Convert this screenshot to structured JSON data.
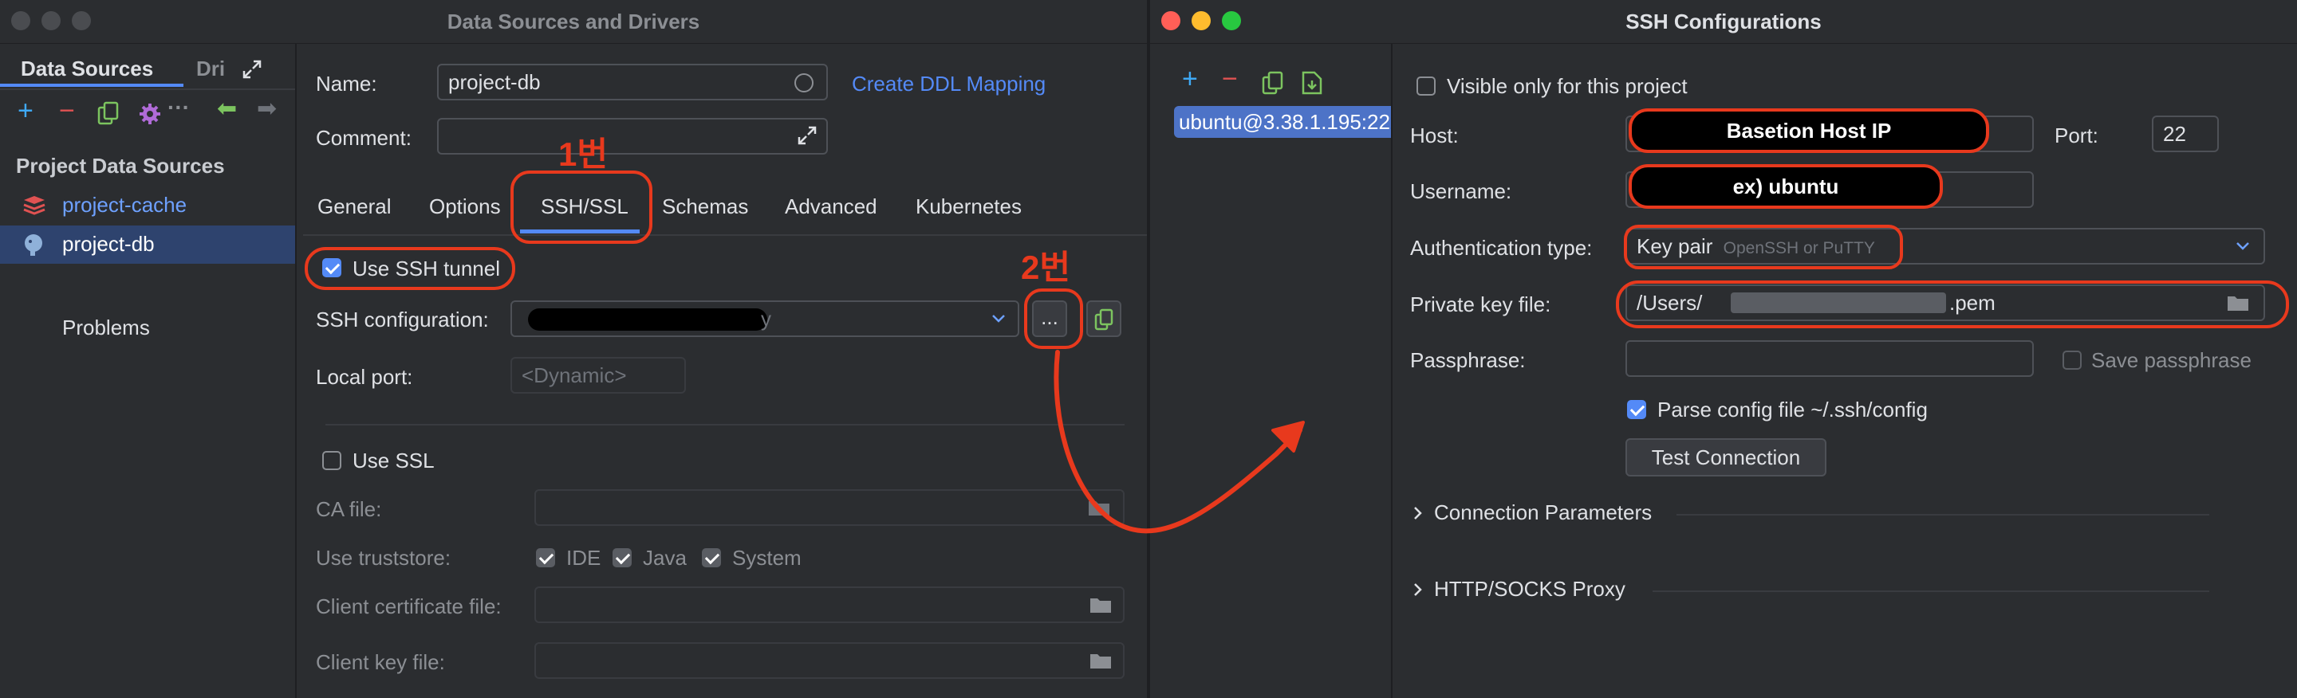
{
  "left_window": {
    "title": "Data Sources and Drivers",
    "sidebar": {
      "tab_data_sources": "Data Sources",
      "tab_drivers": "Dri",
      "section_title": "Project Data Sources",
      "items": [
        {
          "label": "project-cache",
          "icon": "redis-icon"
        },
        {
          "label": "project-db",
          "icon": "postgres-icon"
        }
      ],
      "problems": "Problems"
    },
    "form": {
      "name_label": "Name:",
      "name_value": "project-db",
      "create_ddl_link": "Create DDL Mapping",
      "comment_label": "Comment:",
      "comment_value": "",
      "tabs": [
        "General",
        "Options",
        "SSH/SSL",
        "Schemas",
        "Advanced",
        "Kubernetes"
      ],
      "active_tab": "SSH/SSL",
      "use_ssh_tunnel": "Use SSH tunnel",
      "ssh_config_label": "SSH configuration:",
      "ssh_config_value_suffix": "y",
      "ellipsis_button": "...",
      "local_port_label": "Local port:",
      "local_port_placeholder": "<Dynamic>",
      "use_ssl": "Use SSL",
      "ca_file_label": "CA file:",
      "truststore_label": "Use truststore:",
      "truststore_ide": "IDE",
      "truststore_java": "Java",
      "truststore_system": "System",
      "client_cert_label": "Client certificate file:",
      "client_key_label": "Client key file:"
    }
  },
  "right_window": {
    "title": "SSH Configurations",
    "list_items": [
      "ubuntu@3.38.1.195:22"
    ],
    "visible_only_label": "Visible only for this project",
    "host_label": "Host:",
    "host_overlay": "Basetion Host IP",
    "port_label": "Port:",
    "port_value": "22",
    "username_label": "Username:",
    "username_overlay": "ex) ubuntu",
    "auth_type_label": "Authentication type:",
    "auth_type_value": "Key pair",
    "auth_type_hint": "OpenSSH or PuTTY",
    "private_key_label": "Private key file:",
    "private_key_prefix": "/Users/",
    "private_key_suffix": ".pem",
    "passphrase_label": "Passphrase:",
    "save_passphrase": "Save passphrase",
    "parse_config": "Parse config file ~/.ssh/config",
    "test_connection": "Test Connection",
    "connection_params": "Connection Parameters",
    "http_proxy": "HTTP/SOCKS Proxy"
  },
  "annotations": {
    "step1": "1번",
    "step2": "2번"
  },
  "colors": {
    "accent": "#548af7",
    "annotation_red": "#e8391d",
    "link": "#548af7"
  }
}
